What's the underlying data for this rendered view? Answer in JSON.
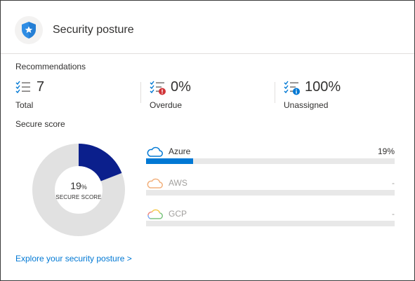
{
  "header": {
    "title": "Security posture",
    "icon": "shield-star-icon"
  },
  "recommendations": {
    "label": "Recommendations",
    "metrics": [
      {
        "value": "7",
        "label": "Total",
        "icon": "checklist-icon"
      },
      {
        "value": "0%",
        "label": "Overdue",
        "icon": "checklist-overdue-icon",
        "badge_color": "#d13438"
      },
      {
        "value": "100%",
        "label": "Unassigned",
        "icon": "checklist-unassigned-icon",
        "badge_color": "#0078d4"
      }
    ]
  },
  "secure_score": {
    "label": "Secure score",
    "value": "19",
    "unit": "%",
    "fraction": 0.19,
    "caption": "SECURE SCORE",
    "fill_color": "#0b1f8c",
    "track_color": "#e1e1e1"
  },
  "providers": [
    {
      "name": "Azure",
      "percent": "19%",
      "fraction": 0.19,
      "icon": "cloud-icon",
      "active": true
    },
    {
      "name": "AWS",
      "percent": "-",
      "fraction": 0,
      "icon": "cloud-icon",
      "active": false
    },
    {
      "name": "GCP",
      "percent": "-",
      "fraction": 0,
      "icon": "cloud-icon",
      "active": false
    }
  ],
  "footer": {
    "link_text": "Explore your security posture >"
  }
}
